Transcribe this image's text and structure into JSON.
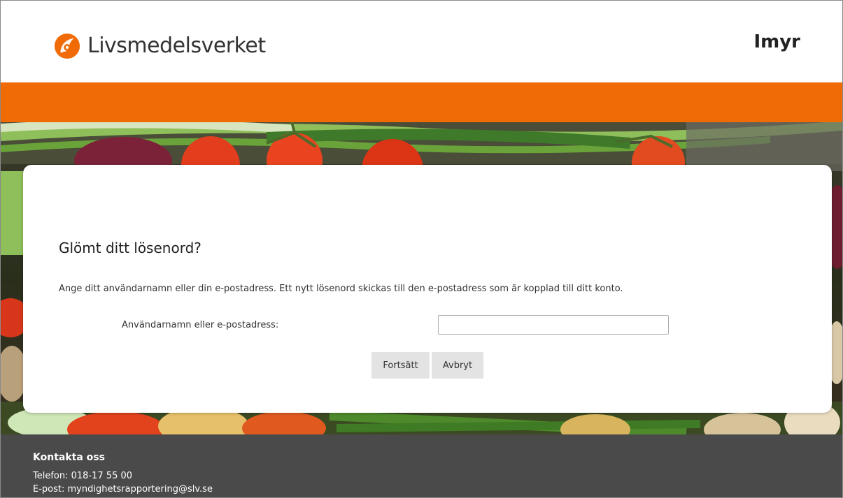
{
  "header": {
    "logo_text": "Livsmedelsverket",
    "user_label": "Imyr"
  },
  "colors": {
    "brand_orange": "#f06a05",
    "footer_bg": "#4a4a4a"
  },
  "form": {
    "title": "Glömt ditt lösenord?",
    "description": "Ange ditt användarnamn eller din e-postadress. Ett nytt lösenord skickas till den e-postadress som är kopplad till ditt konto.",
    "field_label": "Användarnamn eller e-postadress:",
    "field_value": "",
    "continue_label": "Fortsätt",
    "cancel_label": "Avbryt"
  },
  "footer": {
    "title": "Kontakta oss",
    "phone": "Telefon: 018-17 55 00",
    "email": "E-post: myndighetsrapportering@slv.se"
  }
}
